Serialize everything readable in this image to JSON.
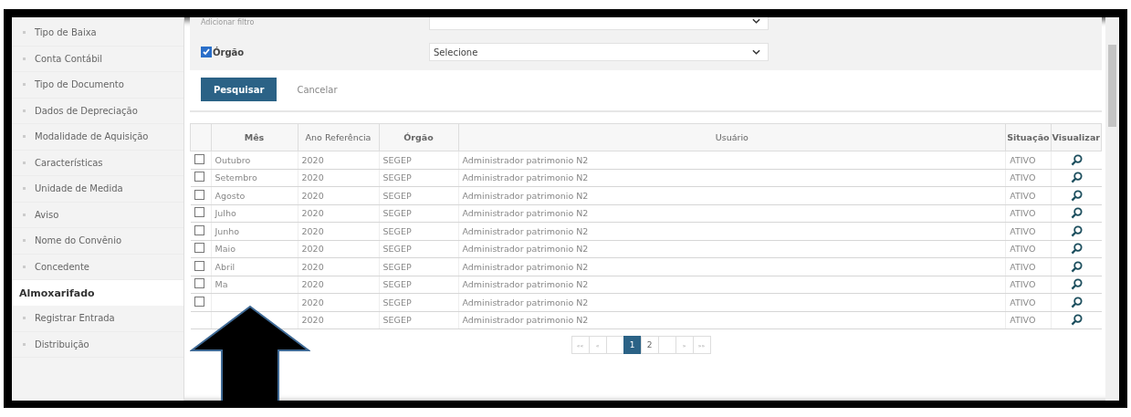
{
  "sidebar": {
    "items": [
      {
        "kind": "item",
        "label": "Tipo de Baixa"
      },
      {
        "kind": "item",
        "label": "Conta Contábil"
      },
      {
        "kind": "item",
        "label": "Tipo de Documento"
      },
      {
        "kind": "item",
        "label": "Dados de Depreciação"
      },
      {
        "kind": "item",
        "label": "Modalidade de Aquisição"
      },
      {
        "kind": "item",
        "label": "Características"
      },
      {
        "kind": "item",
        "label": "Unidade de Medida"
      },
      {
        "kind": "item",
        "label": "Aviso"
      },
      {
        "kind": "item",
        "label": "Nome do Convênio"
      },
      {
        "kind": "item",
        "label": "Concedente"
      },
      {
        "kind": "header",
        "label": "Almoxarifado"
      },
      {
        "kind": "item",
        "label": "Registrar Entrada"
      },
      {
        "kind": "item",
        "label": "Distribuição"
      }
    ]
  },
  "filters": {
    "top_label": "Adicionar filtro",
    "orgao": {
      "label": "Órgão",
      "checked": true,
      "value": "Selecione"
    },
    "buttons": [
      {
        "kind": "primary",
        "label": "Pesquisar"
      },
      {
        "kind": "link",
        "label": "Cancelar"
      }
    ]
  },
  "table": {
    "columns": [
      "Mês",
      "Ano Referência",
      "Órgão",
      "Usuário",
      "Situação",
      "Visualizar"
    ],
    "rows": [
      {
        "checked": false,
        "mes": "Outubro",
        "ano": "2020",
        "orgao": "SEGEP",
        "usuario": "Administrador patrimonio N2",
        "situacao": "ATIVO"
      },
      {
        "checked": false,
        "mes": "Setembro",
        "ano": "2020",
        "orgao": "SEGEP",
        "usuario": "Administrador patrimonio N2",
        "situacao": "ATIVO"
      },
      {
        "checked": false,
        "mes": "Agosto",
        "ano": "2020",
        "orgao": "SEGEP",
        "usuario": "Administrador patrimonio N2",
        "situacao": "ATIVO"
      },
      {
        "checked": false,
        "mes": "Julho",
        "ano": "2020",
        "orgao": "SEGEP",
        "usuario": "Administrador patrimonio N2",
        "situacao": "ATIVO"
      },
      {
        "checked": false,
        "mes": "Junho",
        "ano": "2020",
        "orgao": "SEGEP",
        "usuario": "Administrador patrimonio N2",
        "situacao": "ATIVO"
      },
      {
        "checked": false,
        "mes": "Maio",
        "ano": "2020",
        "orgao": "SEGEP",
        "usuario": "Administrador patrimonio N2",
        "situacao": "ATIVO"
      },
      {
        "checked": false,
        "mes": "Abril",
        "ano": "2020",
        "orgao": "SEGEP",
        "usuario": "Administrador patrimonio N2",
        "situacao": "ATIVO"
      },
      {
        "checked": false,
        "mes": "Ma",
        "ano": "2020",
        "orgao": "SEGEP",
        "usuario": "Administrador patrimonio N2",
        "situacao": "ATIVO"
      },
      {
        "checked": false,
        "ano": "2020",
        "orgao": "SEGEP",
        "usuario": "Administrador patrimonio N2",
        "situacao": "ATIVO"
      },
      {
        "ano": "2020",
        "orgao": "SEGEP",
        "usuario": "Administrador patrimonio N2",
        "situacao": "ATIVO"
      }
    ]
  },
  "pagination": [
    {
      "kind": "nav",
      "label": "««"
    },
    {
      "kind": "nav",
      "label": "«"
    },
    {
      "kind": "blank"
    },
    {
      "kind": "page",
      "label": "1",
      "selected": true
    },
    {
      "kind": "page",
      "label": "2",
      "selected": false
    },
    {
      "kind": "blank"
    },
    {
      "kind": "nav",
      "label": "»"
    },
    {
      "kind": "nav",
      "label": "»»"
    }
  ]
}
